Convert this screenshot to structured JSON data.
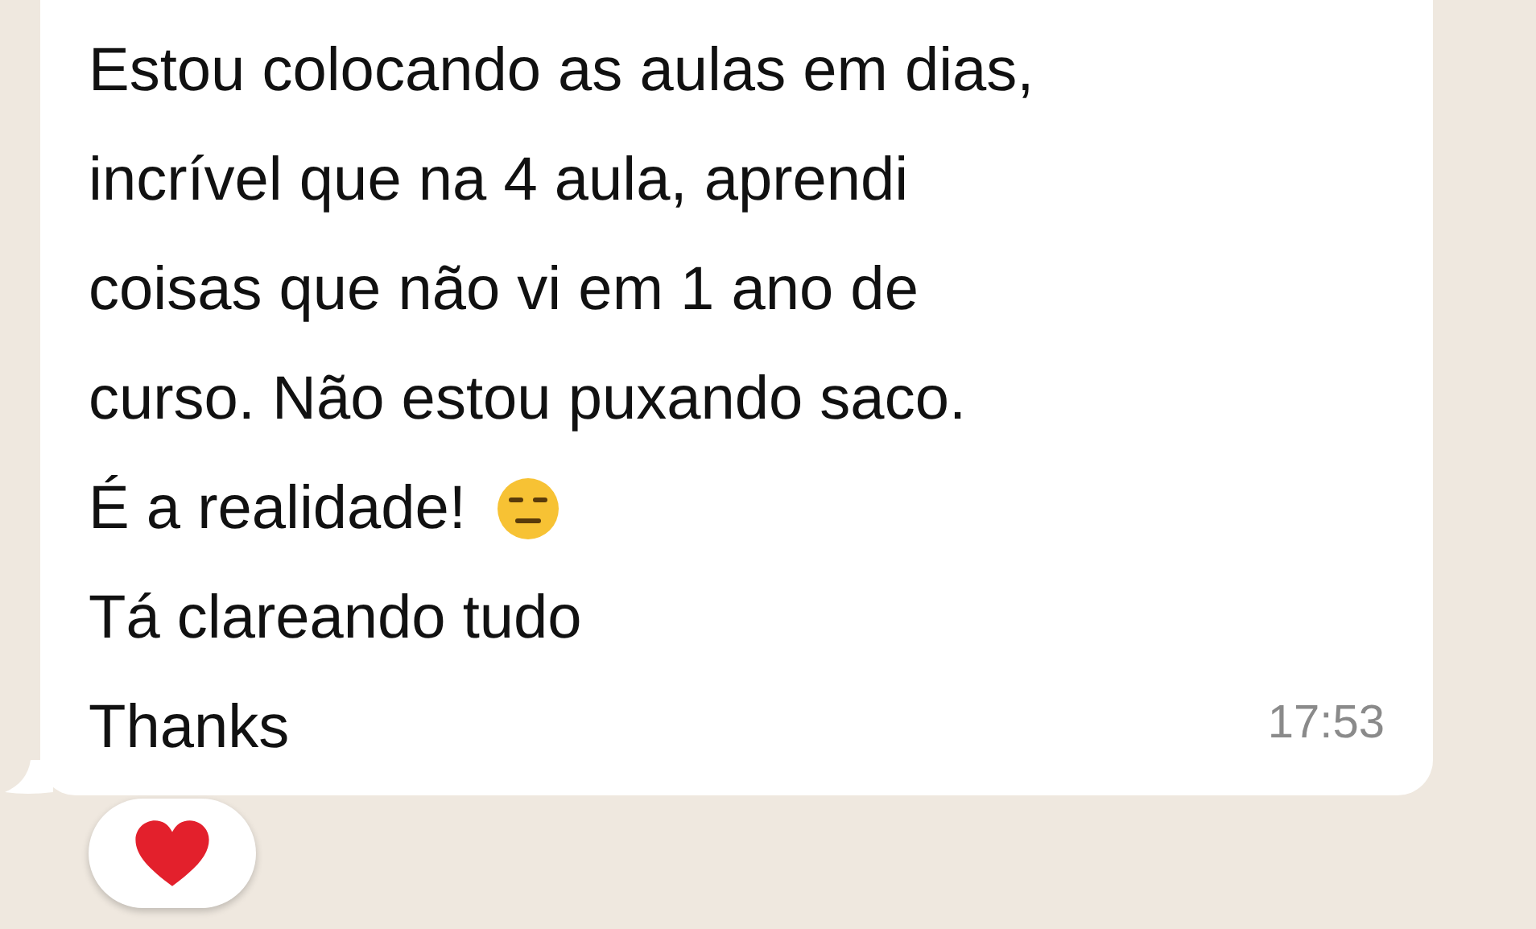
{
  "message": {
    "lines": [
      {
        "text": "Estou colocando as aulas em dias,",
        "emoji": false
      },
      {
        "text": "incrível que na 4 aula, aprendi",
        "emoji": false
      },
      {
        "text": "coisas que não vi em 1 ano de",
        "emoji": false
      },
      {
        "text": "curso. Não estou puxando saco.",
        "emoji": false
      },
      {
        "text": "É a realidade!",
        "emoji": true
      },
      {
        "text": "Tá clareando tudo",
        "emoji": false
      },
      {
        "text": "Thanks",
        "emoji": false
      }
    ],
    "time": "17:53"
  },
  "reaction": {
    "kind": "heart"
  }
}
